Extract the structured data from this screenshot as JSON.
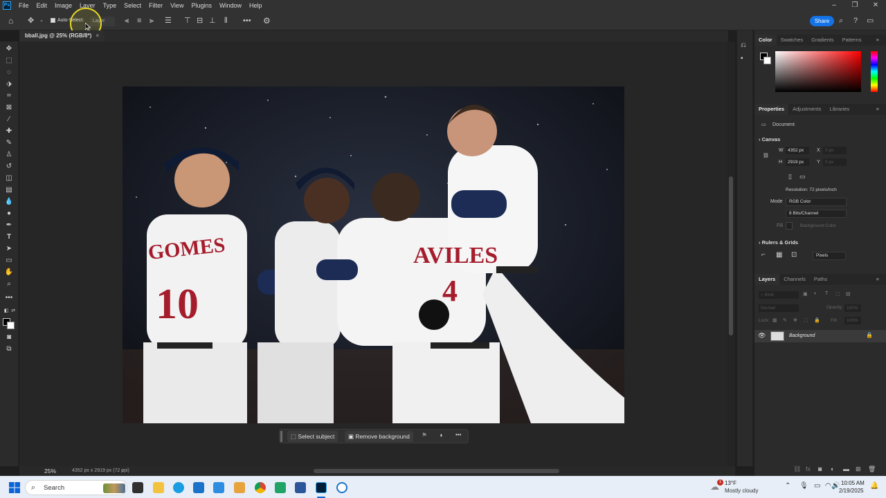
{
  "menubar": {
    "app_icon": "photoshop-logo",
    "app_icon_text": "Ps",
    "items": [
      "File",
      "Edit",
      "Image",
      "Layer",
      "Type",
      "Select",
      "Filter",
      "View",
      "Plugins",
      "Window",
      "Help"
    ]
  },
  "options_bar": {
    "auto_select_label": "Auto-Select:",
    "layer_select_value": "Layer",
    "share_label": "Share"
  },
  "document": {
    "tab_title": "bball.jpg @ 25% (RGB/8*)",
    "zoom": "25%",
    "info": "4352 px x 2919 px (72 ppi)"
  },
  "photo": {
    "jersey_left": "GOMES",
    "number_left": "10",
    "jersey_center": "AVILES",
    "number_center": "4"
  },
  "context_bar": {
    "select_subject": "Select subject",
    "remove_background": "Remove background"
  },
  "color_panel": {
    "tabs": [
      "Color",
      "Swatches",
      "Gradients",
      "Patterns"
    ],
    "active_tab": "Color",
    "hue_color": "#ff0000"
  },
  "properties_panel": {
    "tabs": [
      "Properties",
      "Adjustments",
      "Libraries"
    ],
    "doc_label": "Document",
    "canvas_title": "Canvas",
    "w_label": "W",
    "w_value": "4352 px",
    "h_label": "H",
    "h_value": "2919 px",
    "x_label": "X",
    "x_value": "0 px",
    "y_label": "Y",
    "y_value": "0 px",
    "resolution": "Resolution: 72 pixels/inch",
    "mode_label": "Mode",
    "mode_value": "RGB Color",
    "bits_value": "8 Bits/Channel",
    "fill_label": "Fill",
    "fill_value": "Background Color",
    "rulers_title": "Rulers & Grids",
    "units_value": "Pixels"
  },
  "layers_panel": {
    "tabs": [
      "Layers",
      "Channels",
      "Paths"
    ],
    "kind_placeholder": "Kind",
    "blend_mode": "Normal",
    "opacity_label": "Opacity:",
    "opacity_value": "100%",
    "lock_label": "Lock:",
    "fill_label": "Fill:",
    "fill_value": "100%",
    "layer_name": "Background"
  },
  "taskbar": {
    "search_placeholder": "Search",
    "weather_temp": "13°F",
    "weather_desc": "Mostly cloudy",
    "weather_badge": "1",
    "time": "10:05 AM",
    "date": "2/19/2025"
  }
}
